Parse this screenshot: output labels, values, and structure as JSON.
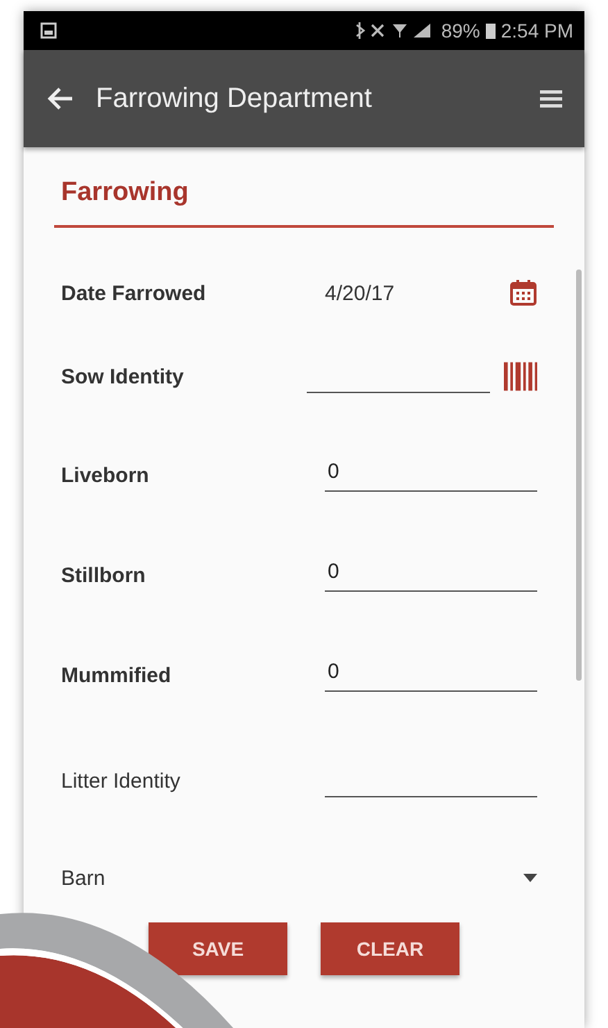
{
  "status_bar": {
    "battery": "89%",
    "time": "2:54 PM"
  },
  "app_bar": {
    "title": "Farrowing Department"
  },
  "section": {
    "title": "Farrowing"
  },
  "fields": [
    {
      "kind": "date",
      "label": "Date Farrowed",
      "value": "4/20/17",
      "required": true
    },
    {
      "kind": "barcode",
      "label": "Sow Identity",
      "required": true
    },
    {
      "kind": "number",
      "label": "Liveborn",
      "value": "0",
      "required": true
    },
    {
      "kind": "number",
      "label": "Stillborn",
      "value": "0",
      "required": true
    },
    {
      "kind": "number",
      "label": "Mummified",
      "value": "0",
      "required": true
    },
    {
      "kind": "text",
      "label": "Litter Identity",
      "required": false
    },
    {
      "kind": "dropdown",
      "label": "Barn",
      "required": false
    }
  ],
  "buttons": [
    "SAVE",
    "CLEAR"
  ]
}
